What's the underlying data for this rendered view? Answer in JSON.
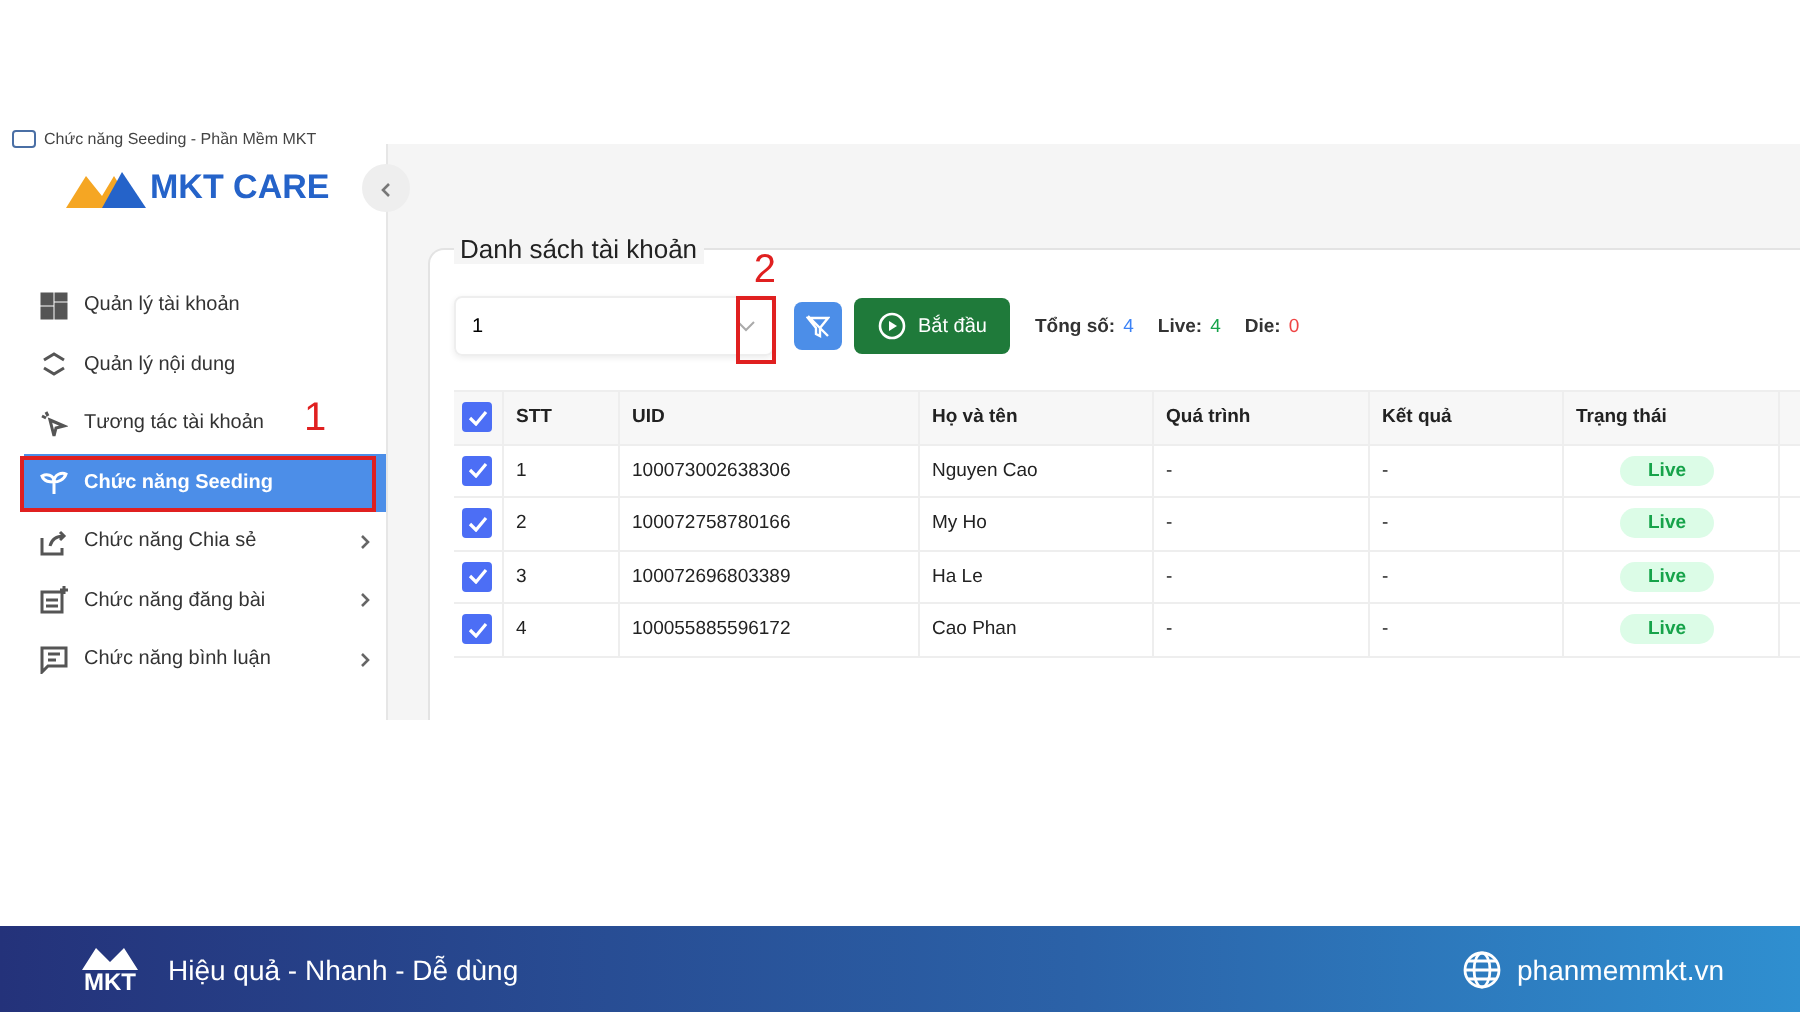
{
  "window": {
    "title": "Chức năng Seeding - Phần Mềm MKT"
  },
  "sidebar": {
    "logo_text": "MKT CARE",
    "items": [
      {
        "label": "Quản lý tài khoản",
        "selected": false,
        "has_children": false
      },
      {
        "label": "Quản lý nội dung",
        "selected": false,
        "has_children": false
      },
      {
        "label": "Tương tác tài khoản",
        "selected": false,
        "has_children": false
      },
      {
        "label": "Chức năng Seeding",
        "selected": true,
        "has_children": false,
        "annotation": "1"
      },
      {
        "label": "Chức năng Chia sẻ",
        "selected": false,
        "has_children": true
      },
      {
        "label": "Chức năng đăng bài",
        "selected": false,
        "has_children": true
      },
      {
        "label": "Chức năng bình luận",
        "selected": false,
        "has_children": true
      }
    ]
  },
  "panel": {
    "title": "Danh sách tài khoản",
    "select": {
      "value": "1",
      "annotation": "2"
    },
    "start_button": "Bắt đầu",
    "stats": [
      {
        "label": "Tổng số:",
        "value": "4",
        "color": "#3b82f6"
      },
      {
        "label": "Live:",
        "value": "4",
        "color": "#16a34a"
      },
      {
        "label": "Die:",
        "value": "0",
        "color": "#ef4444"
      }
    ]
  },
  "table": {
    "all_checked": true,
    "columns": [
      "STT",
      "UID",
      "Họ và tên",
      "Quá trình",
      "Kết quả",
      "Trạng thái"
    ],
    "rows": [
      {
        "checked": true,
        "cells": [
          "1",
          "100073002638306",
          "Nguyen Cao",
          "-",
          "-"
        ],
        "status": "Live"
      },
      {
        "checked": true,
        "cells": [
          "2",
          "100072758780166",
          "My Ho",
          "-",
          "-"
        ],
        "status": "Live"
      },
      {
        "checked": true,
        "cells": [
          "3",
          "100072696803389",
          "Ha Le",
          "-",
          "-"
        ],
        "status": "Live"
      },
      {
        "checked": true,
        "cells": [
          "4",
          "100055885596172",
          "Cao Phan",
          "-",
          "-"
        ],
        "status": "Live"
      }
    ]
  },
  "footer": {
    "logo_text": "MKT",
    "slogan": "Hiệu quả - Nhanh - Dễ dùng",
    "website": "phanmemmkt.vn"
  }
}
